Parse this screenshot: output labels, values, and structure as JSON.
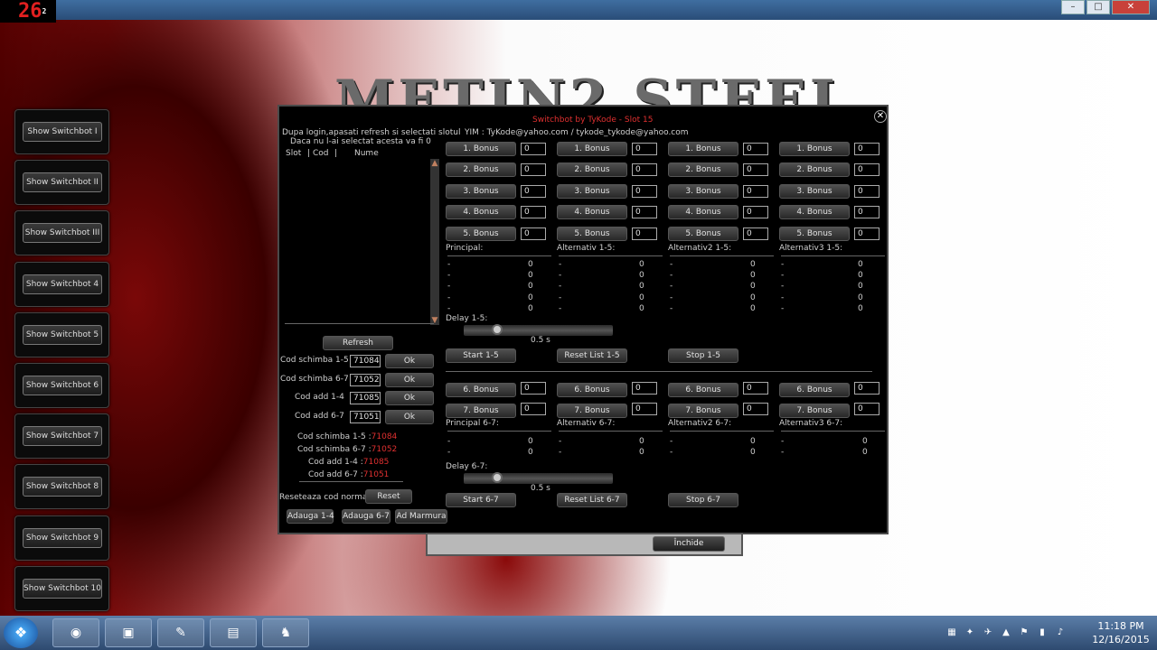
{
  "counter": {
    "value": "26",
    "sub": "2"
  },
  "logo": {
    "text": "METIN2 STEEL"
  },
  "window_buttons": {
    "minimize": "–",
    "maximize": "□",
    "close": "✕"
  },
  "left_buttons": [
    "Show Switchbot I",
    "Show Switchbot II",
    "Show Switchbot III",
    "Show Switchbot 4",
    "Show Switchbot 5",
    "Show Switchbot 6",
    "Show Switchbot 7",
    "Show Switchbot 8",
    "Show Switchbot 9",
    "Show Switchbot 10"
  ],
  "switchbot": {
    "title": "Switchbot by TyKode - Slot 15",
    "yim": "YIM : TyKode@yahoo.com / tykode_tykode@yahoo.com",
    "instructions_1": "Dupa login,apasati refresh si selectati slotul",
    "instructions_2": "Daca nu l-ai selectat acesta va fi 0",
    "list_headers": {
      "slot": "Slot",
      "cod": "Cod",
      "nume": "Nume",
      "sep": "|"
    },
    "refresh": "Refresh",
    "codes": [
      {
        "label": "Cod schimba 1-5",
        "value": "71084",
        "ok": "Ok"
      },
      {
        "label": "Cod schimba 6-7",
        "value": "71052",
        "ok": "Ok"
      },
      {
        "label": "Cod add 1-4",
        "value": "71085",
        "ok": "Ok"
      },
      {
        "label": "Cod add 6-7",
        "value": "71051",
        "ok": "Ok"
      }
    ],
    "code_summary": [
      {
        "label": "Cod schimba 1-5 :",
        "value": "71084"
      },
      {
        "label": "Cod schimba 6-7 :",
        "value": "71052"
      },
      {
        "label": "Cod add 1-4 :",
        "value": "71085"
      },
      {
        "label": "Cod add 6-7 :",
        "value": "71051"
      }
    ],
    "reset_label": "Reseteaza cod normal",
    "reset_button": "Reset",
    "bottom_buttons": [
      "Adauga 1-4",
      "Adauga 6-7",
      "Ad Marmura"
    ],
    "bonus_labels": [
      "1. Bonus",
      "2. Bonus",
      "3. Bonus",
      "4. Bonus",
      "5. Bonus"
    ],
    "bonus_labels_67": [
      "6. Bonus",
      "7. Bonus"
    ],
    "bonus_value": "0",
    "columns_15": [
      "Principal:",
      "Alternativ 1-5:",
      "Alternativ2 1-5:",
      "Alternativ3 1-5:"
    ],
    "columns_67": [
      "Principal 6-7:",
      "Alternativ 6-7:",
      "Alternativ2 6-7:",
      "Alternativ3 6-7:"
    ],
    "dash": "-",
    "delay_15_label": "Delay 1-5:",
    "delay_15_value": "0.5 s",
    "delay_67_label": "Delay 6-7:",
    "delay_67_value": "0.5 s",
    "delay_15_level": 0.2,
    "delay_67_level": 0.2,
    "start_15": "Start 1-5",
    "reset_15": "Reset List 1-5",
    "stop_15": "Stop 1-5",
    "start_67": "Start 6-7",
    "reset_67": "Reset List 6-7",
    "stop_67": "Stop 6-7",
    "close_glyph": "✕",
    "inchide": "Închide"
  },
  "taskbar": {
    "start_glyph": "❖",
    "apps": [
      "firefox-icon",
      "terminal-icon",
      "notepad-icon",
      "folder-icon",
      "game-icon"
    ],
    "app_glyphs": [
      "◉",
      "▣",
      "✎",
      "▤",
      "♞"
    ],
    "tray_glyphs": [
      "▦",
      "✦",
      "✈",
      "▲",
      "⚑",
      "▮",
      "♪"
    ],
    "time": "11:18 PM",
    "date": "12/16/2015"
  }
}
